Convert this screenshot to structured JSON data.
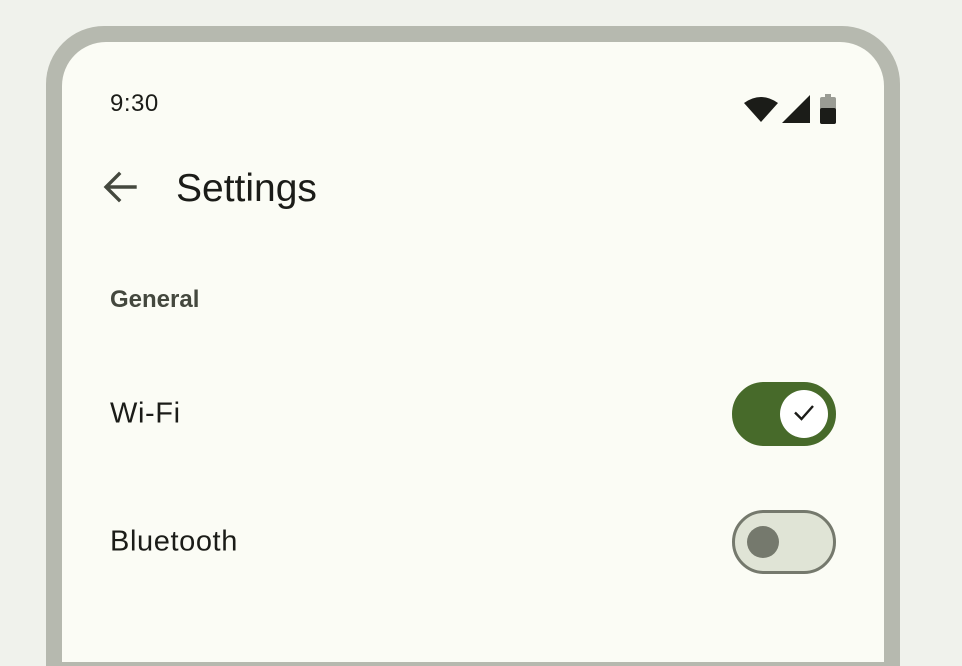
{
  "status_bar": {
    "time": "9:30",
    "icons": [
      "wifi-icon",
      "cellular-signal-icon",
      "battery-icon"
    ]
  },
  "top_bar": {
    "back_icon": "arrow-back-icon",
    "title": "Settings"
  },
  "sections": [
    {
      "header": "General",
      "items": [
        {
          "label": "Wi-Fi",
          "toggle": "on",
          "toggle_icon": "check-icon"
        },
        {
          "label": "Bluetooth",
          "toggle": "off"
        }
      ]
    }
  ],
  "colors": {
    "background": "#f0f2ec",
    "device_frame": "#b6b9af",
    "screen_surface": "#fbfcf5",
    "switch_on_track": "#476a2a",
    "switch_off_track": "#e0e4d6",
    "switch_off_outline": "#75796d",
    "text_primary": "#1b1c18",
    "text_secondary": "#44483e"
  }
}
